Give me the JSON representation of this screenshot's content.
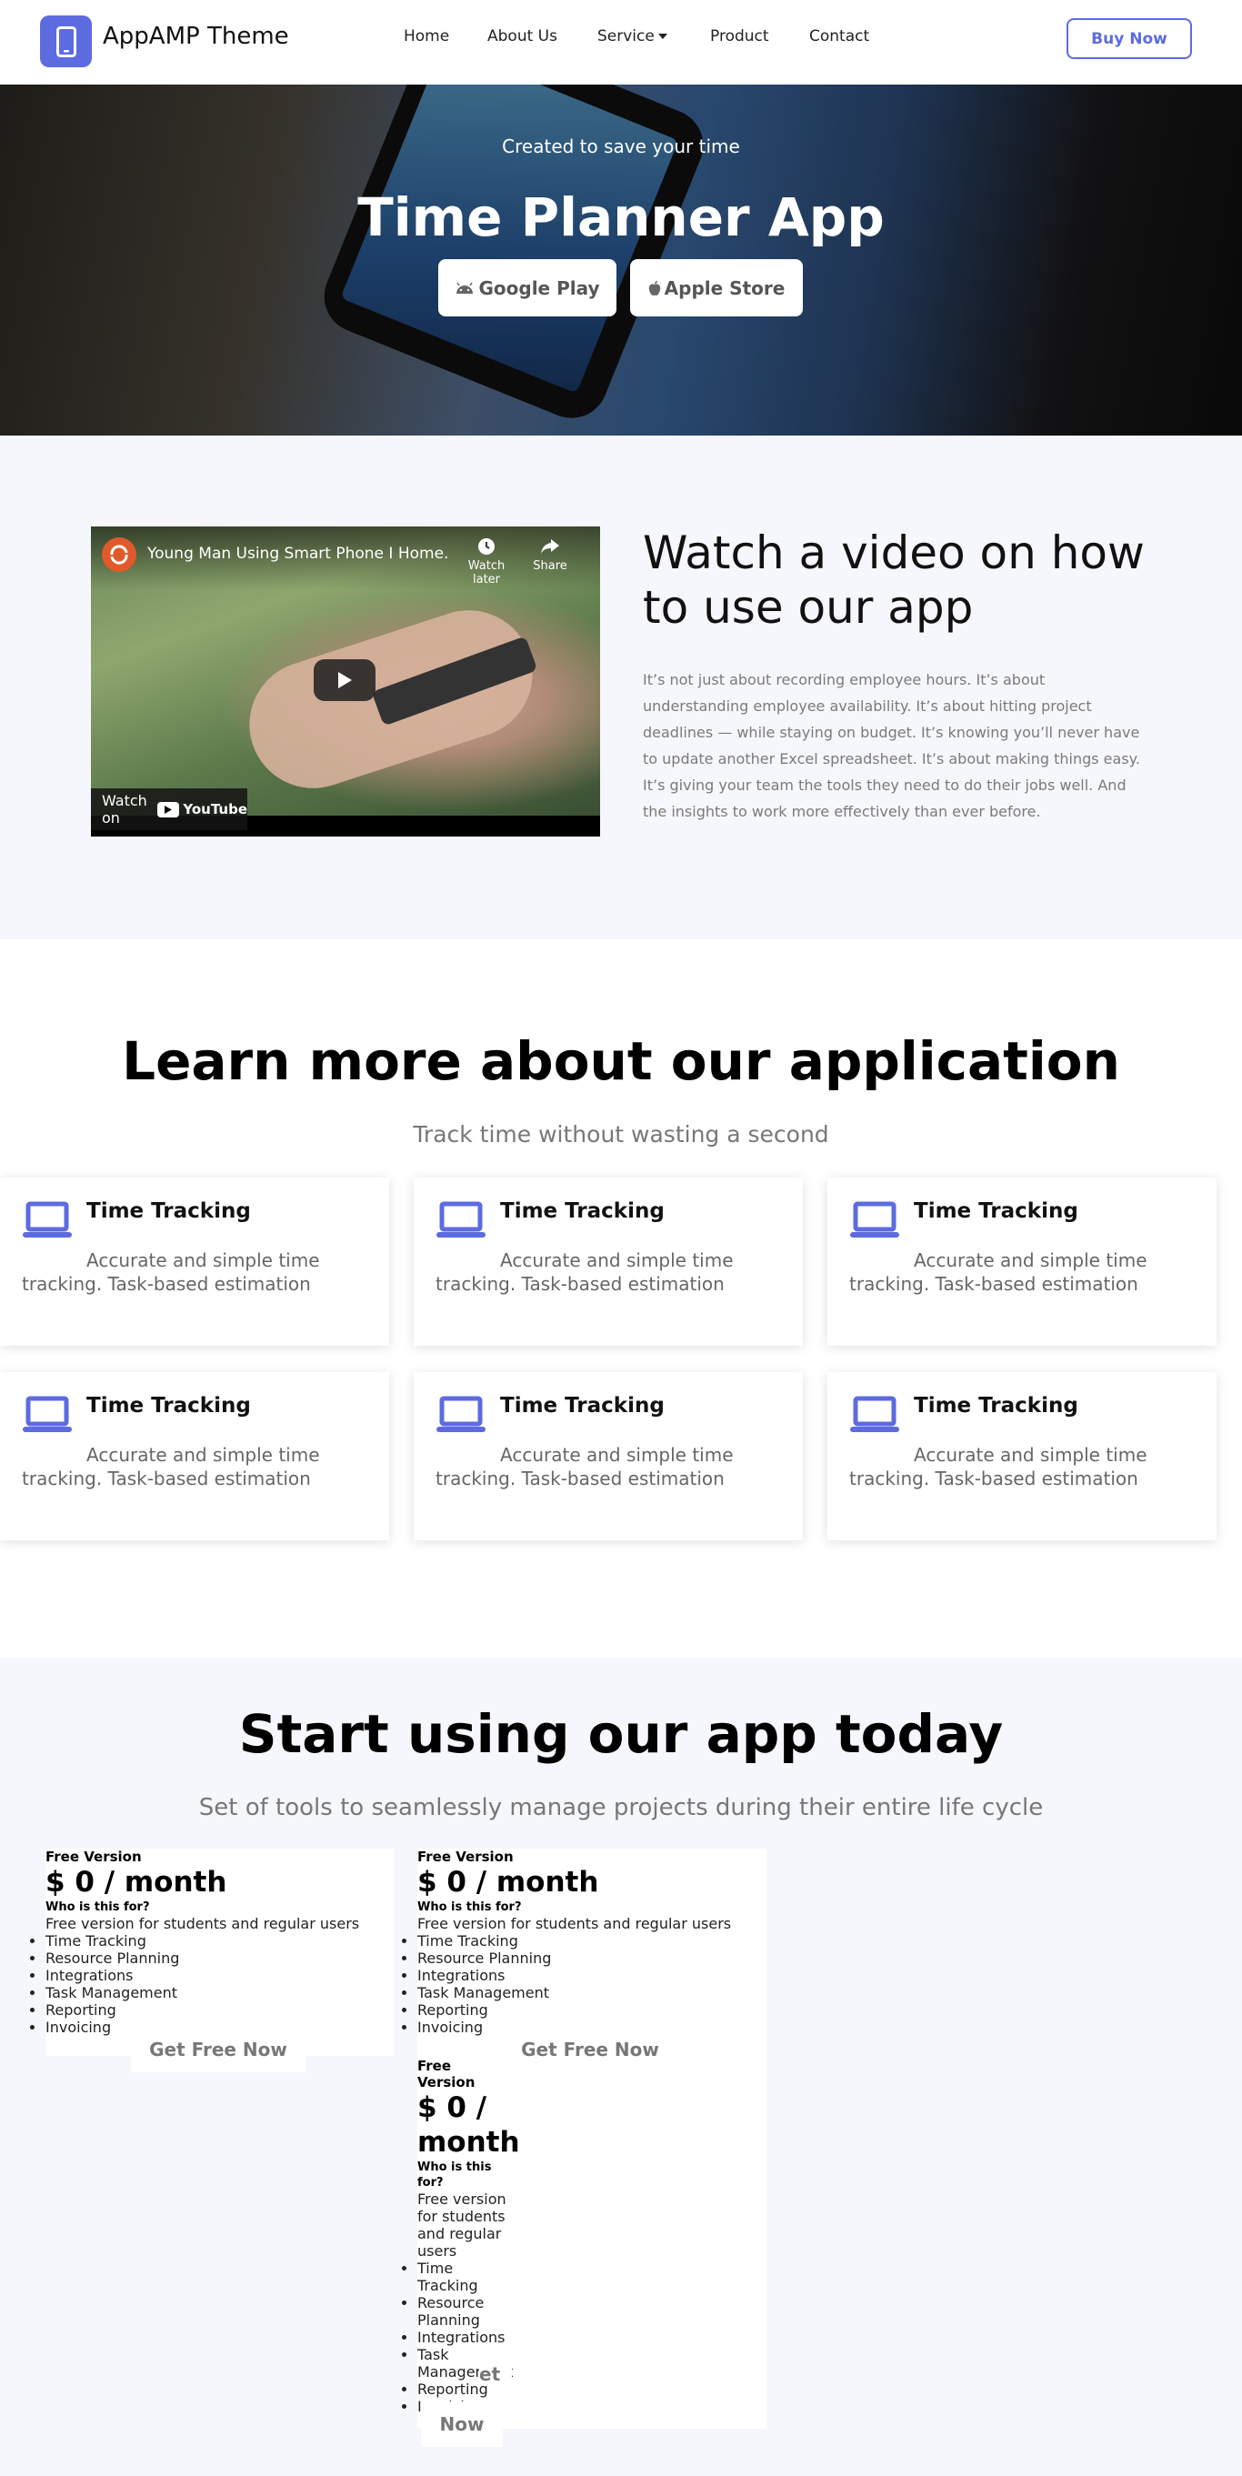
{
  "navbar": {
    "brand": "AppAMP Theme",
    "logo_icon": "smartphone-icon",
    "links": [
      "Home",
      "About Us",
      "Service",
      "Product",
      "Contact"
    ],
    "buy_button": "Buy Now",
    "accent_color": "#5d6be0"
  },
  "hero": {
    "subtitle": "Created to save your time",
    "title": "Time Planner App",
    "google_play": "Google Play",
    "apple_store": "Apple Store"
  },
  "video": {
    "video_title": "Young Man Using Smart Phone I Home...",
    "watch_later": "Watch later",
    "share": "Share",
    "watch_on": "Watch on",
    "youtube": "YouTube",
    "heading": "Watch a video on how to use our app",
    "body": "It’s not just about recording employee hours. It’s about understanding employee availability. It’s about hitting project deadlines — while staying on budget. It’s knowing you’ll never have to update another Excel spreadsheet. It’s about making things easy. It’s giving your team the tools they need to do their jobs well. And the insights to work more effectively than ever before."
  },
  "learn": {
    "title": "Learn more about our application",
    "subtitle": "Track time without wasting a second",
    "cards": [
      {
        "title": "Time Tracking",
        "text": "Accurate and simple time tracking. Task-based estimation",
        "icon": "laptop-icon"
      },
      {
        "title": "Time Tracking",
        "text": "Accurate and simple time tracking. Task-based estimation",
        "icon": "laptop-icon"
      },
      {
        "title": "Time Tracking",
        "text": "Accurate and simple time tracking. Task-based estimation",
        "icon": "laptop-icon"
      },
      {
        "title": "Time Tracking",
        "text": "Accurate and simple time tracking. Task-based estimation",
        "icon": "laptop-icon"
      },
      {
        "title": "Time Tracking",
        "text": "Accurate and simple time tracking. Task-based estimation",
        "icon": "laptop-icon"
      },
      {
        "title": "Time Tracking",
        "text": "Accurate and simple time tracking. Task-based estimation",
        "icon": "laptop-icon"
      }
    ]
  },
  "pricing": {
    "title": "Start using our app today",
    "subtitle": "Set of tools to seamlessly manage projects during their entire life cycle",
    "plans": [
      {
        "name": "Free Version",
        "price": "$ 0 / month",
        "who": "Who is this for?",
        "desc": "Free version for students and regular users",
        "features": [
          "Time Tracking",
          "Resource Planning",
          "Integrations",
          "Task Management",
          "Reporting",
          "Invoicing"
        ],
        "button": "Get Free Now"
      },
      {
        "name": "Free Version",
        "price": "$ 0 / month",
        "who": "Who is this for?",
        "desc": "Free version for students and regular users",
        "features": [
          "Time Tracking",
          "Resource Planning",
          "Integrations",
          "Task Management",
          "Reporting",
          "Invoicing"
        ],
        "button": "Get Free Now"
      },
      {
        "name": "Free Version",
        "price": "$ 0 / month",
        "who": "Who is this for?",
        "desc": "Free version for students and regular users",
        "features": [
          "Time Tracking",
          "Resource Planning",
          "Integrations",
          "Task Management",
          "Reporting",
          "Invoicing"
        ],
        "button_overlap": "et",
        "button": "Now"
      }
    ]
  }
}
